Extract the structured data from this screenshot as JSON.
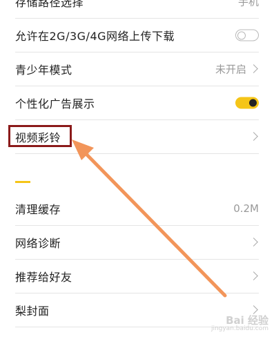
{
  "settings": {
    "rows": [
      {
        "label": "存储路径选择",
        "value": "手机"
      },
      {
        "label": "允许在2G/3G/4G网络上传下载",
        "toggle": "off"
      },
      {
        "label": "青少年模式",
        "value": "未开启"
      },
      {
        "label": "个性化广告展示",
        "toggle": "on"
      },
      {
        "label": "视频彩铃"
      },
      {
        "label": "清理缓存",
        "value": "0.2M"
      },
      {
        "label": "网络诊断"
      },
      {
        "label": "推荐给好友"
      },
      {
        "label": "梨封面"
      }
    ]
  },
  "colors": {
    "accent": "#f5c518",
    "highlight_box": "#8b1a1a",
    "arrow": "#f2955a"
  },
  "watermark": {
    "text": "Bai 经验",
    "sub": "jingyan.baidu.com"
  }
}
